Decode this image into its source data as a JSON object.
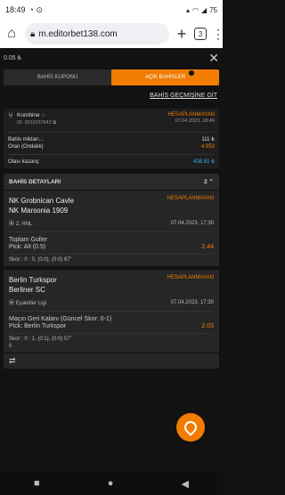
{
  "status": {
    "time": "18:49",
    "battery": "75"
  },
  "browser": {
    "url": "m.editorbet138.com",
    "tabs": "3"
  },
  "top": {
    "balance": "0.05 ₺"
  },
  "tabs": {
    "coupon": "BAHİS KUPONU",
    "open": "AÇIK BAHİSLER"
  },
  "history_link": "BAHİS GEÇMİŞİNE GİT",
  "bet": {
    "type": "Kombine",
    "id": "ID: 3011037943",
    "status": "HESAPLANMAYAN",
    "date": "07.04.2023, 18:49",
    "amount_label": "Bahis miktarı...",
    "amount": "111 ₺",
    "odds_label": "Oran (Ondalık)",
    "odds": "4.953",
    "possible_label": "Olası kazanç",
    "possible": "438.81 ₺"
  },
  "details": {
    "title": "BAHİS DETAYLARI",
    "count": "2"
  },
  "matches": [
    {
      "home": "NK Grobnican Cavle",
      "away": "NK Marsonia 1909",
      "status": "HESAPLANMAYAN",
      "league": "2. HNL",
      "date": "07.04.2023, 17:30",
      "market": "Toplam Goller",
      "pick": "Pick: Alt (0.5)",
      "odd": "2.44",
      "score": "Skor : 0 : 0, (0:0), (0:0) 67'",
      "extra": ""
    },
    {
      "home": "Berlin Turkspor",
      "away": "Berliner SC",
      "status": "HESAPLANMAYAN",
      "league": "Eyaletler Ligi",
      "date": "07.04.2023, 17:30",
      "market": "Maçın Geri Kalanı (Güncel Skor: 0-1)",
      "pick": "Pick: Berlin Turkspor",
      "odd": "2.03",
      "score": "Skor : 0 : 1, (0:1), (0:0) 57'",
      "extra": "0"
    }
  ],
  "colors": {
    "accent": "#f07c00",
    "possible": "#3db0e8"
  }
}
